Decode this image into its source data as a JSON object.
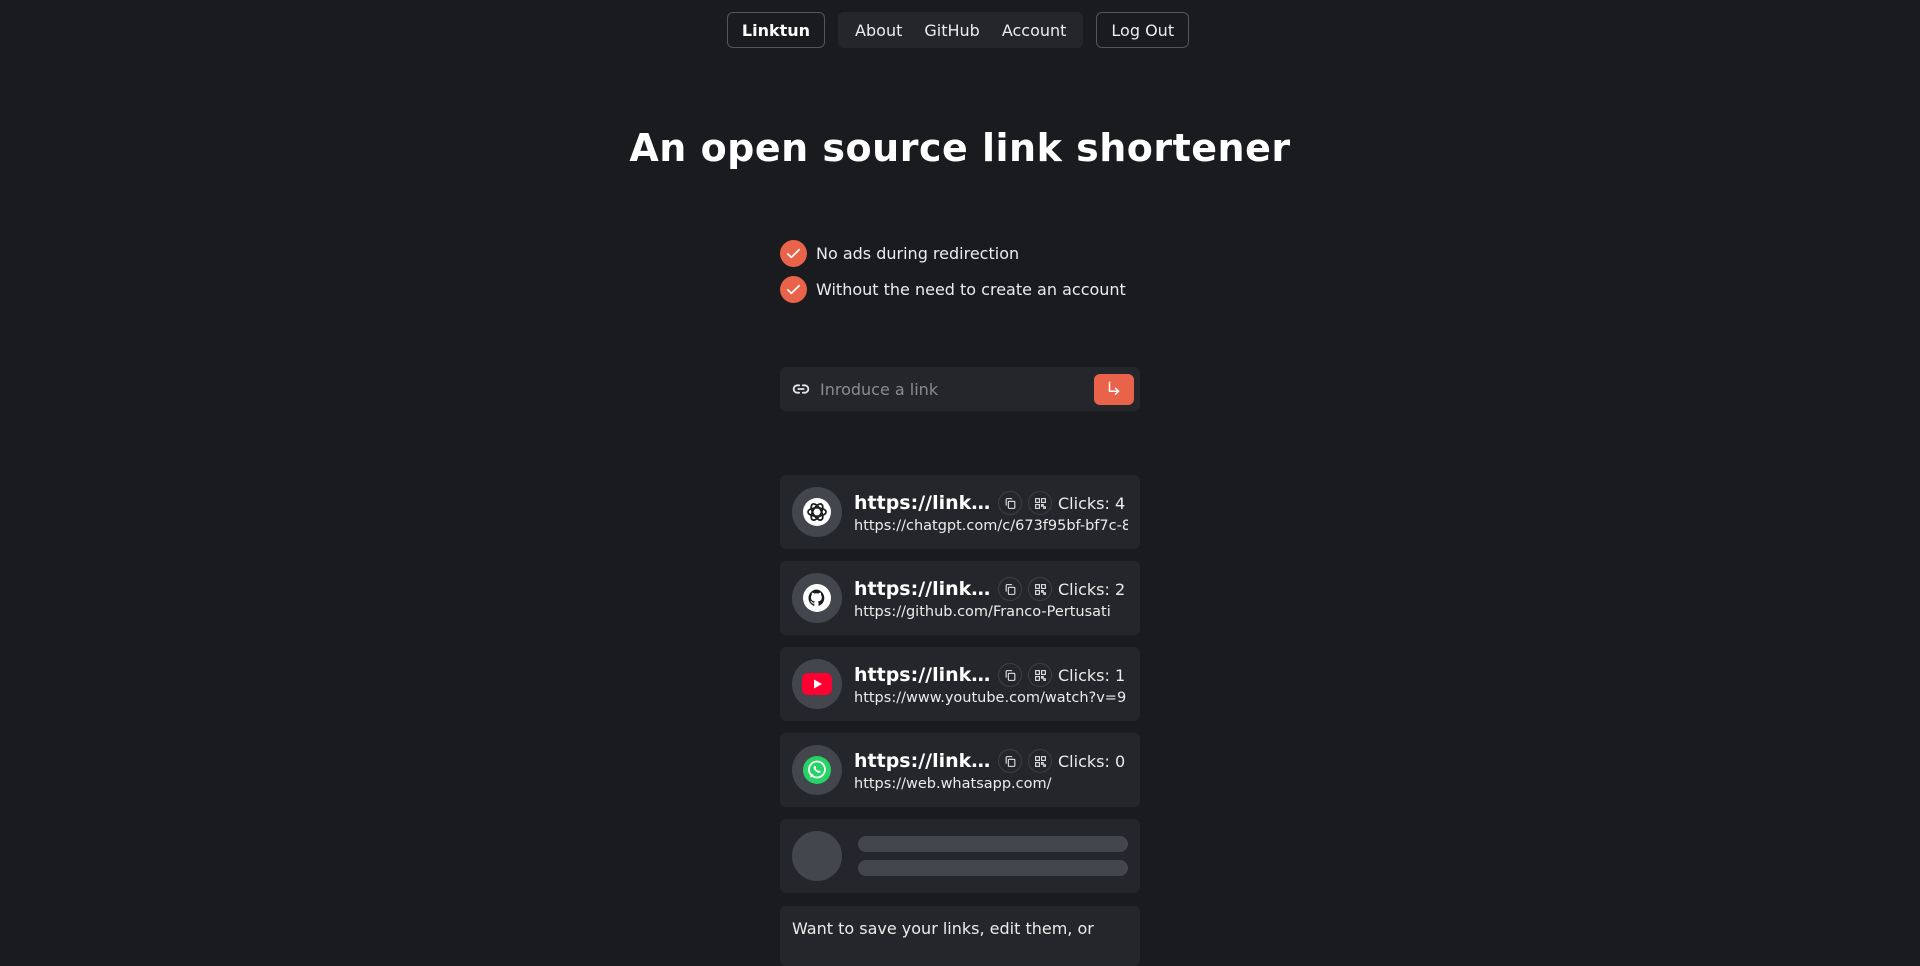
{
  "nav": {
    "brand": "Linktun",
    "links": [
      "About",
      "GitHub",
      "Account"
    ],
    "logout": "Log Out"
  },
  "hero": {
    "title": "An open source link shortener"
  },
  "features": [
    "No ads during redirection",
    "Without the need to create an account"
  ],
  "search": {
    "placeholder": "Inroduce a link",
    "value": ""
  },
  "links": [
    {
      "icon": "chatgpt-icon",
      "short": "https://link...",
      "clicks": "Clicks: 4",
      "original": "https://chatgpt.com/c/673f95bf-bf7c-8"
    },
    {
      "icon": "github-icon",
      "short": "https://link...",
      "clicks": "Clicks: 2",
      "original": "https://github.com/Franco-Pertusati"
    },
    {
      "icon": "youtube-icon",
      "short": "https://link...",
      "clicks": "Clicks: 1",
      "original": "https://www.youtube.com/watch?v=9"
    },
    {
      "icon": "whatsapp-icon",
      "short": "https://link...",
      "clicks": "Clicks: 0",
      "original": "https://web.whatsapp.com/"
    }
  ],
  "cta": {
    "text": "Want to save your links, edit them, or"
  },
  "colors": {
    "accent": "#e8634a",
    "background": "#1a1b1e",
    "card": "#25262b"
  }
}
